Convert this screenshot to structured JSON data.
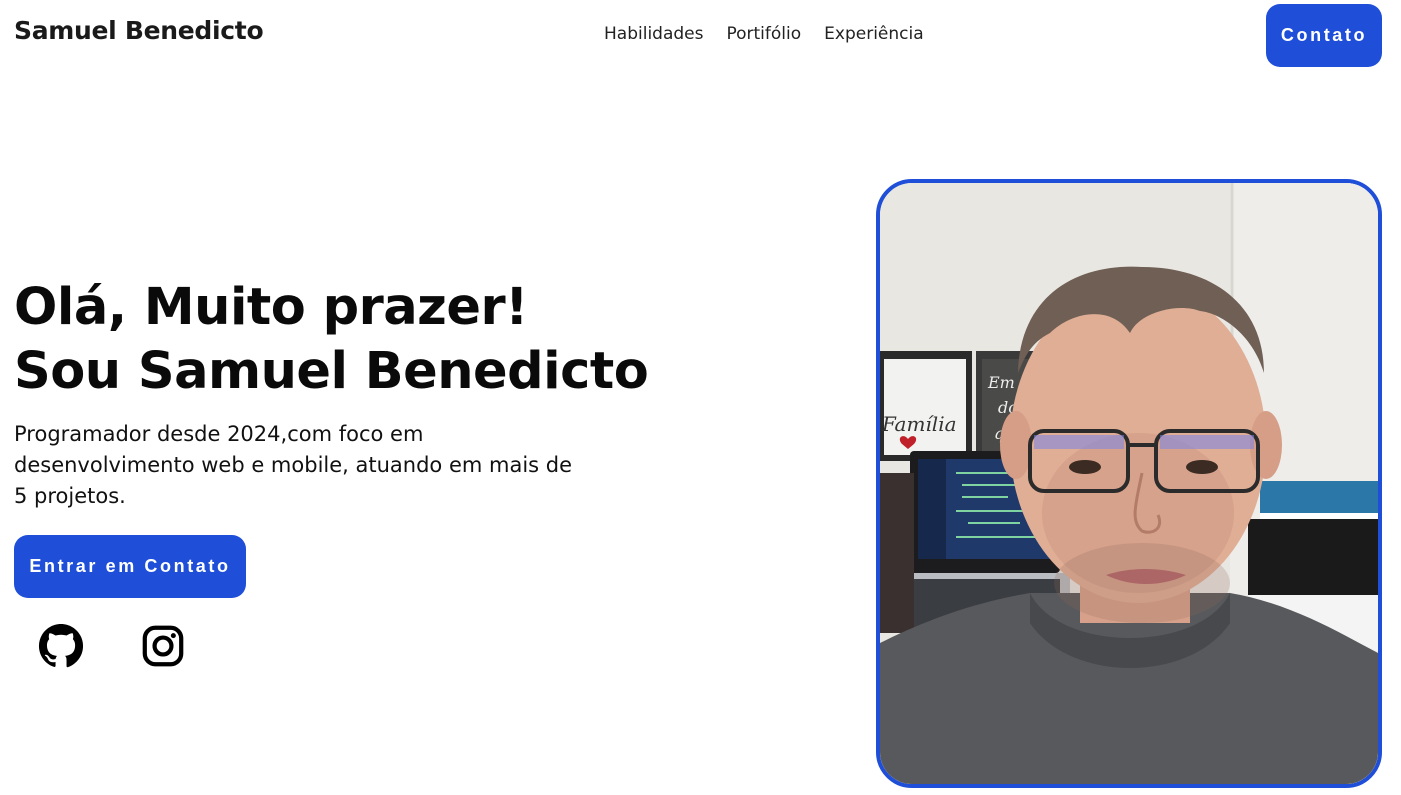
{
  "header": {
    "brand": "Samuel Benedicto",
    "nav": [
      "Habilidades",
      "Portifólio",
      "Experiência"
    ],
    "contact_button": "Contato"
  },
  "hero": {
    "title_line1": "Olá, Muito prazer!",
    "title_line2": "Sou Samuel Benedicto",
    "description": "Programador desde 2024,com foco em desenvolvimento web e mobile, atuando em mais de 5 projetos.",
    "cta_button": "Entrar em Contato",
    "social": [
      "github-icon",
      "instagram-icon"
    ]
  },
  "photo": {
    "poster_text": "Família"
  },
  "colors": {
    "accent": "#1f4fd8",
    "text": "#0a0a0a",
    "background": "#ffffff"
  }
}
